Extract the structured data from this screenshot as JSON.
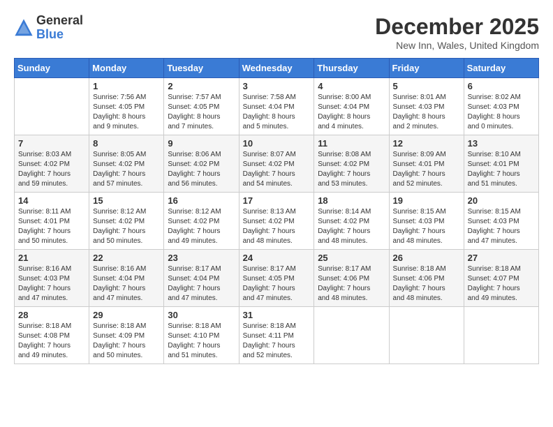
{
  "logo": {
    "general": "General",
    "blue": "Blue"
  },
  "header": {
    "month": "December 2025",
    "location": "New Inn, Wales, United Kingdom"
  },
  "weekdays": [
    "Sunday",
    "Monday",
    "Tuesday",
    "Wednesday",
    "Thursday",
    "Friday",
    "Saturday"
  ],
  "weeks": [
    [
      {
        "day": "",
        "detail": ""
      },
      {
        "day": "1",
        "detail": "Sunrise: 7:56 AM\nSunset: 4:05 PM\nDaylight: 8 hours\nand 9 minutes."
      },
      {
        "day": "2",
        "detail": "Sunrise: 7:57 AM\nSunset: 4:05 PM\nDaylight: 8 hours\nand 7 minutes."
      },
      {
        "day": "3",
        "detail": "Sunrise: 7:58 AM\nSunset: 4:04 PM\nDaylight: 8 hours\nand 5 minutes."
      },
      {
        "day": "4",
        "detail": "Sunrise: 8:00 AM\nSunset: 4:04 PM\nDaylight: 8 hours\nand 4 minutes."
      },
      {
        "day": "5",
        "detail": "Sunrise: 8:01 AM\nSunset: 4:03 PM\nDaylight: 8 hours\nand 2 minutes."
      },
      {
        "day": "6",
        "detail": "Sunrise: 8:02 AM\nSunset: 4:03 PM\nDaylight: 8 hours\nand 0 minutes."
      }
    ],
    [
      {
        "day": "7",
        "detail": "Sunrise: 8:03 AM\nSunset: 4:02 PM\nDaylight: 7 hours\nand 59 minutes."
      },
      {
        "day": "8",
        "detail": "Sunrise: 8:05 AM\nSunset: 4:02 PM\nDaylight: 7 hours\nand 57 minutes."
      },
      {
        "day": "9",
        "detail": "Sunrise: 8:06 AM\nSunset: 4:02 PM\nDaylight: 7 hours\nand 56 minutes."
      },
      {
        "day": "10",
        "detail": "Sunrise: 8:07 AM\nSunset: 4:02 PM\nDaylight: 7 hours\nand 54 minutes."
      },
      {
        "day": "11",
        "detail": "Sunrise: 8:08 AM\nSunset: 4:02 PM\nDaylight: 7 hours\nand 53 minutes."
      },
      {
        "day": "12",
        "detail": "Sunrise: 8:09 AM\nSunset: 4:01 PM\nDaylight: 7 hours\nand 52 minutes."
      },
      {
        "day": "13",
        "detail": "Sunrise: 8:10 AM\nSunset: 4:01 PM\nDaylight: 7 hours\nand 51 minutes."
      }
    ],
    [
      {
        "day": "14",
        "detail": "Sunrise: 8:11 AM\nSunset: 4:01 PM\nDaylight: 7 hours\nand 50 minutes."
      },
      {
        "day": "15",
        "detail": "Sunrise: 8:12 AM\nSunset: 4:02 PM\nDaylight: 7 hours\nand 50 minutes."
      },
      {
        "day": "16",
        "detail": "Sunrise: 8:12 AM\nSunset: 4:02 PM\nDaylight: 7 hours\nand 49 minutes."
      },
      {
        "day": "17",
        "detail": "Sunrise: 8:13 AM\nSunset: 4:02 PM\nDaylight: 7 hours\nand 48 minutes."
      },
      {
        "day": "18",
        "detail": "Sunrise: 8:14 AM\nSunset: 4:02 PM\nDaylight: 7 hours\nand 48 minutes."
      },
      {
        "day": "19",
        "detail": "Sunrise: 8:15 AM\nSunset: 4:03 PM\nDaylight: 7 hours\nand 48 minutes."
      },
      {
        "day": "20",
        "detail": "Sunrise: 8:15 AM\nSunset: 4:03 PM\nDaylight: 7 hours\nand 47 minutes."
      }
    ],
    [
      {
        "day": "21",
        "detail": "Sunrise: 8:16 AM\nSunset: 4:03 PM\nDaylight: 7 hours\nand 47 minutes."
      },
      {
        "day": "22",
        "detail": "Sunrise: 8:16 AM\nSunset: 4:04 PM\nDaylight: 7 hours\nand 47 minutes."
      },
      {
        "day": "23",
        "detail": "Sunrise: 8:17 AM\nSunset: 4:04 PM\nDaylight: 7 hours\nand 47 minutes."
      },
      {
        "day": "24",
        "detail": "Sunrise: 8:17 AM\nSunset: 4:05 PM\nDaylight: 7 hours\nand 47 minutes."
      },
      {
        "day": "25",
        "detail": "Sunrise: 8:17 AM\nSunset: 4:06 PM\nDaylight: 7 hours\nand 48 minutes."
      },
      {
        "day": "26",
        "detail": "Sunrise: 8:18 AM\nSunset: 4:06 PM\nDaylight: 7 hours\nand 48 minutes."
      },
      {
        "day": "27",
        "detail": "Sunrise: 8:18 AM\nSunset: 4:07 PM\nDaylight: 7 hours\nand 49 minutes."
      }
    ],
    [
      {
        "day": "28",
        "detail": "Sunrise: 8:18 AM\nSunset: 4:08 PM\nDaylight: 7 hours\nand 49 minutes."
      },
      {
        "day": "29",
        "detail": "Sunrise: 8:18 AM\nSunset: 4:09 PM\nDaylight: 7 hours\nand 50 minutes."
      },
      {
        "day": "30",
        "detail": "Sunrise: 8:18 AM\nSunset: 4:10 PM\nDaylight: 7 hours\nand 51 minutes."
      },
      {
        "day": "31",
        "detail": "Sunrise: 8:18 AM\nSunset: 4:11 PM\nDaylight: 7 hours\nand 52 minutes."
      },
      {
        "day": "",
        "detail": ""
      },
      {
        "day": "",
        "detail": ""
      },
      {
        "day": "",
        "detail": ""
      }
    ]
  ]
}
